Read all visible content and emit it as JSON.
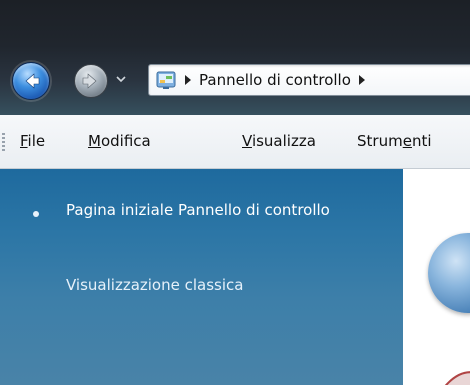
{
  "address": {
    "path_text": "Pannello di controllo"
  },
  "menubar": {
    "items": [
      {
        "pre": "",
        "accel": "F",
        "post": "ile"
      },
      {
        "pre": "",
        "accel": "M",
        "post": "odifica"
      },
      {
        "pre": "",
        "accel": "V",
        "post": "isualizza"
      },
      {
        "pre": "Strum",
        "accel": "e",
        "post": "nti"
      }
    ]
  },
  "taskpane": {
    "home_link": "Pagina iniziale Pannello di controllo",
    "classic_link": "Visualizzazione classica"
  },
  "colors": {
    "taskpane_top": "#1e6a9e",
    "taskpane_bottom": "#4983a8",
    "link_text": "#ffffff"
  },
  "icons": {
    "back": "back-arrow-icon",
    "forward": "forward-arrow-icon",
    "dropdown": "chevron-down-icon",
    "address": "control-panel-icon"
  }
}
